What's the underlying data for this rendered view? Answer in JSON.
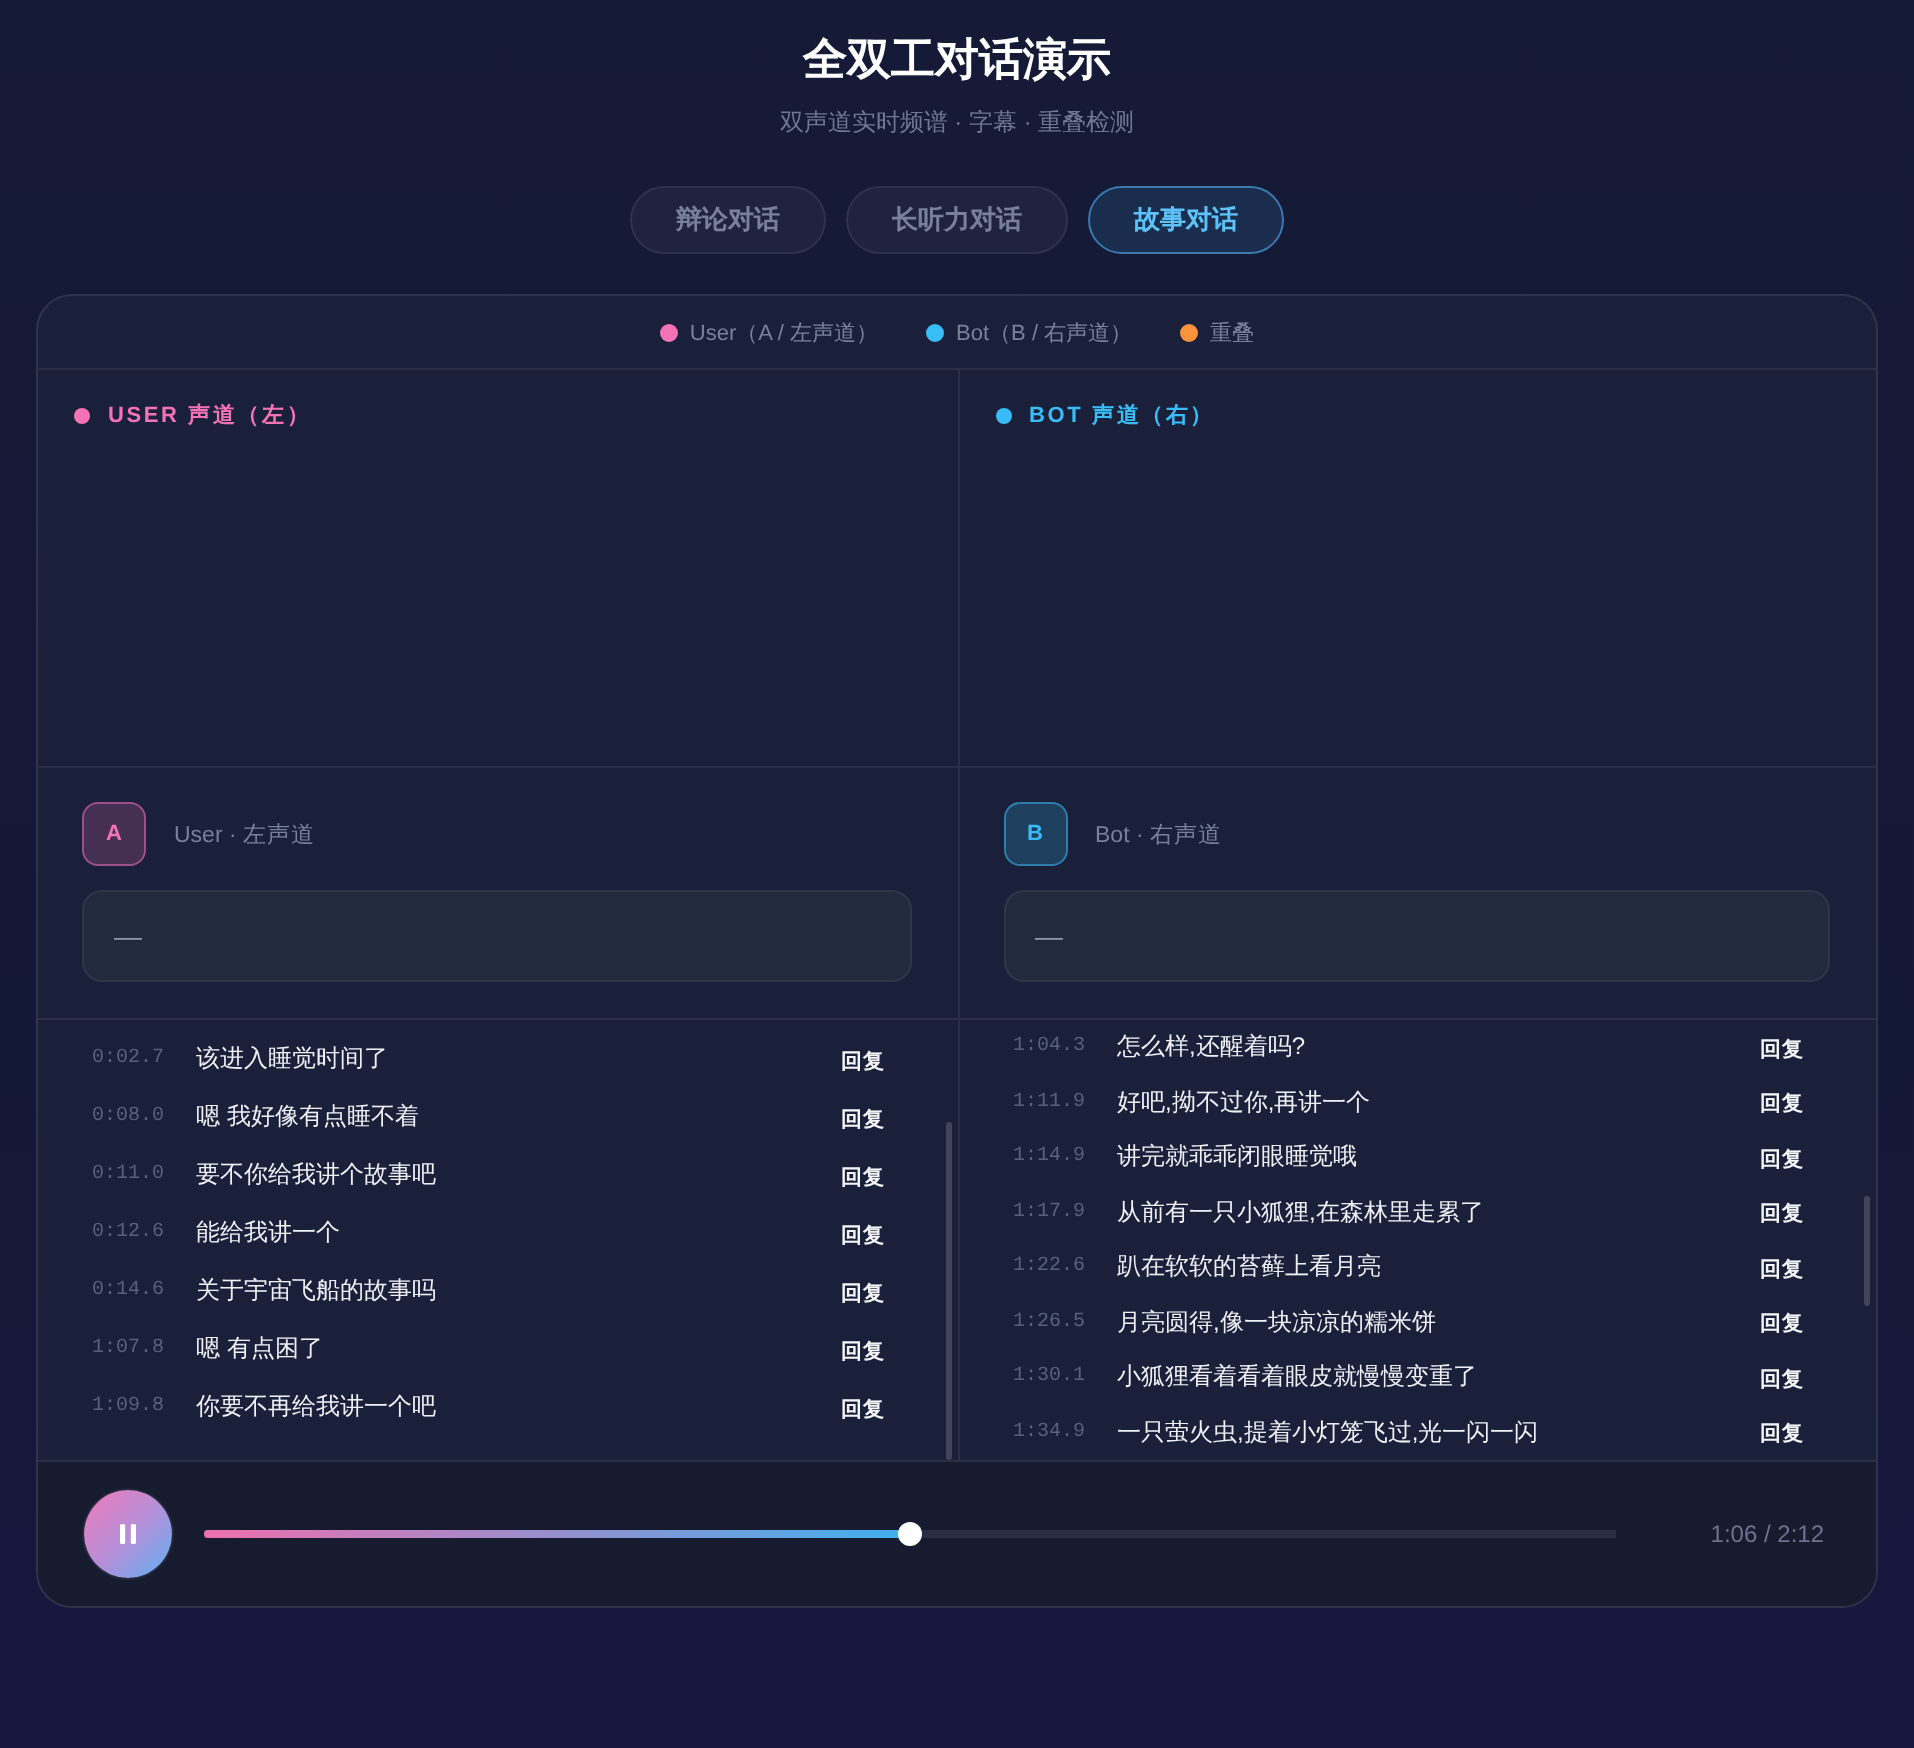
{
  "header": {
    "title": "全双工对话演示",
    "subtitle": "双声道实时频谱 · 字幕 · 重叠检测"
  },
  "tabs": [
    {
      "label": "辩论对话",
      "selected": false
    },
    {
      "label": "长听力对话",
      "selected": false
    },
    {
      "label": "故事对话",
      "selected": true
    }
  ],
  "legend": [
    {
      "label": "User（A / 左声道）",
      "color": "#f472b6"
    },
    {
      "label": "Bot（B / 右声道）",
      "color": "#38bdf8"
    },
    {
      "label": "重叠",
      "color": "#fb923c"
    }
  ],
  "channels": [
    {
      "title": "USER 声道（左）",
      "color": "#f472b6",
      "avatar": "A",
      "speaker": "User · 左声道",
      "caption": "—",
      "transcript": [
        {
          "time": "0:02.7",
          "text": "该进入睡觉时间了",
          "action": "回复"
        },
        {
          "time": "0:08.0",
          "text": "嗯 我好像有点睡不着",
          "action": "回复"
        },
        {
          "time": "0:11.0",
          "text": "要不你给我讲个故事吧",
          "action": "回复"
        },
        {
          "time": "0:12.6",
          "text": "能给我讲一个",
          "action": "回复"
        },
        {
          "time": "0:14.6",
          "text": "关于宇宙飞船的故事吗",
          "action": "回复"
        },
        {
          "time": "1:07.8",
          "text": "嗯 有点困了",
          "action": "回复"
        },
        {
          "time": "1:09.8",
          "text": "你要不再给我讲一个吧",
          "action": "回复"
        }
      ]
    },
    {
      "title": "BOT 声道（右）",
      "color": "#38bdf8",
      "avatar": "B",
      "speaker": "Bot · 右声道",
      "caption": "—",
      "transcript": [
        {
          "time": "1:04.3",
          "text": "怎么样,还醒着吗?",
          "action": "回复"
        },
        {
          "time": "1:11.9",
          "text": "好吧,拗不过你,再讲一个",
          "action": "回复"
        },
        {
          "time": "1:14.9",
          "text": "讲完就乖乖闭眼睡觉哦",
          "action": "回复"
        },
        {
          "time": "1:17.9",
          "text": "从前有一只小狐狸,在森林里走累了",
          "action": "回复"
        },
        {
          "time": "1:22.6",
          "text": "趴在软软的苔藓上看月亮",
          "action": "回复"
        },
        {
          "time": "1:26.5",
          "text": "月亮圆得,像一块凉凉的糯米饼",
          "action": "回复"
        },
        {
          "time": "1:30.1",
          "text": "小狐狸看着看着眼皮就慢慢变重了",
          "action": "回复"
        },
        {
          "time": "1:34.9",
          "text": "一只萤火虫,提着小灯笼飞过,光一闪一闪",
          "action": "回复"
        }
      ]
    }
  ],
  "player": {
    "playing": true,
    "level": 0.5,
    "time": "1:06 / 2:12"
  }
}
